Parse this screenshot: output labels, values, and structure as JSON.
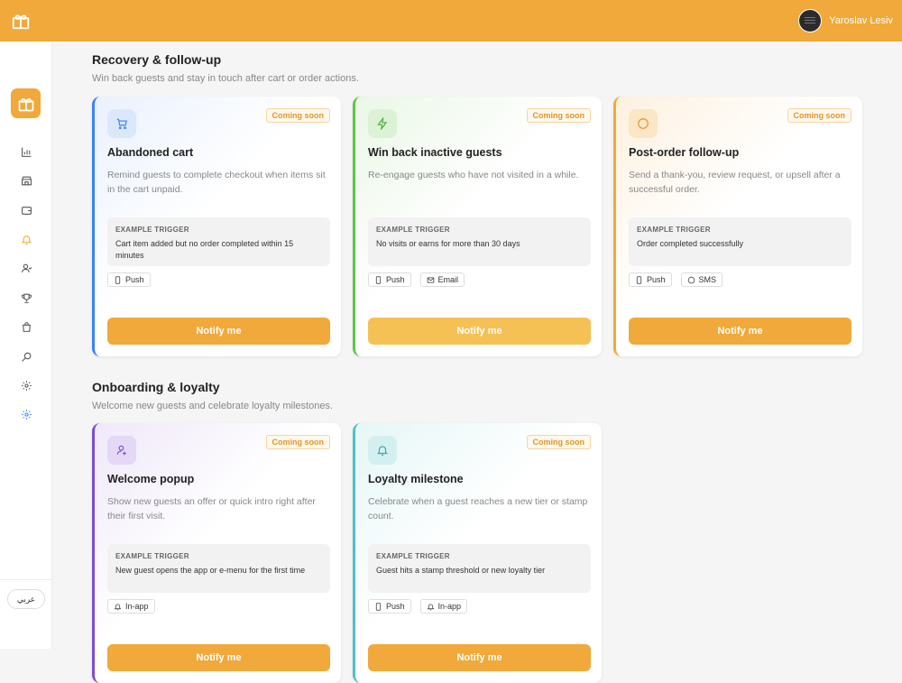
{
  "header": {
    "user_name": "Yaroslav Lesiv"
  },
  "sidebar": {
    "items": [
      {
        "icon": "chart-icon"
      },
      {
        "icon": "store-icon"
      },
      {
        "icon": "wallet-icon"
      },
      {
        "icon": "bell-icon",
        "active": true
      },
      {
        "icon": "users-icon"
      },
      {
        "icon": "trophy-icon"
      },
      {
        "icon": "bag-icon"
      },
      {
        "icon": "search-icon"
      },
      {
        "icon": "gear-icon"
      },
      {
        "icon": "gear-icon"
      }
    ],
    "language_label": "عربي"
  },
  "sections": [
    {
      "title": "Recovery & follow-up",
      "subtitle": "Win back guests and stay in touch after cart or order actions.",
      "cards": [
        {
          "icon": "cart-icon",
          "badge": "Coming soon",
          "title": "Abandoned cart",
          "description": "Remind guests to complete checkout when items sit in the cart unpaid.",
          "trigger_label": "EXAMPLE TRIGGER",
          "trigger": "Cart item added but no order completed within 15 minutes",
          "channels": [
            "Push"
          ],
          "button": "Notify me",
          "accent": "#3b82f6"
        },
        {
          "icon": "bolt-icon",
          "badge": "Coming soon",
          "title": "Win back inactive guests",
          "description": "Re-engage guests who have not visited in a while.",
          "trigger_label": "EXAMPLE TRIGGER",
          "trigger": "No visits or earns for more than 30 days",
          "channels": [
            "Push",
            "Email"
          ],
          "button": "Notify me",
          "accent": "#5ec44a"
        },
        {
          "icon": "chat-icon",
          "badge": "Coming soon",
          "title": "Post-order follow-up",
          "description": "Send a thank-you, review request, or upsell after a successful order.",
          "trigger_label": "EXAMPLE TRIGGER",
          "trigger": "Order completed successfully",
          "channels": [
            "Push",
            "SMS"
          ],
          "button": "Notify me",
          "accent": "#f0a93a"
        }
      ]
    },
    {
      "title": "Onboarding & loyalty",
      "subtitle": "Welcome new guests and celebrate loyalty milestones.",
      "cards": [
        {
          "icon": "user-plus-icon",
          "badge": "Coming soon",
          "title": "Welcome popup",
          "description": "Show new guests an offer or quick intro right after their first visit.",
          "trigger_label": "EXAMPLE TRIGGER",
          "trigger": "New guest opens the app or e-menu for the first time",
          "channels": [
            "In-app"
          ],
          "button": "Notify me",
          "accent": "#7c4dce"
        },
        {
          "icon": "bell-icon",
          "badge": "Coming soon",
          "title": "Loyalty milestone",
          "description": "Celebrate when a guest reaches a new tier or stamp count.",
          "trigger_label": "EXAMPLE TRIGGER",
          "trigger": "Guest hits a stamp threshold or new loyalty tier",
          "channels": [
            "Push",
            "In-app"
          ],
          "button": "Notify me",
          "accent": "#4fc1c6"
        }
      ]
    }
  ]
}
